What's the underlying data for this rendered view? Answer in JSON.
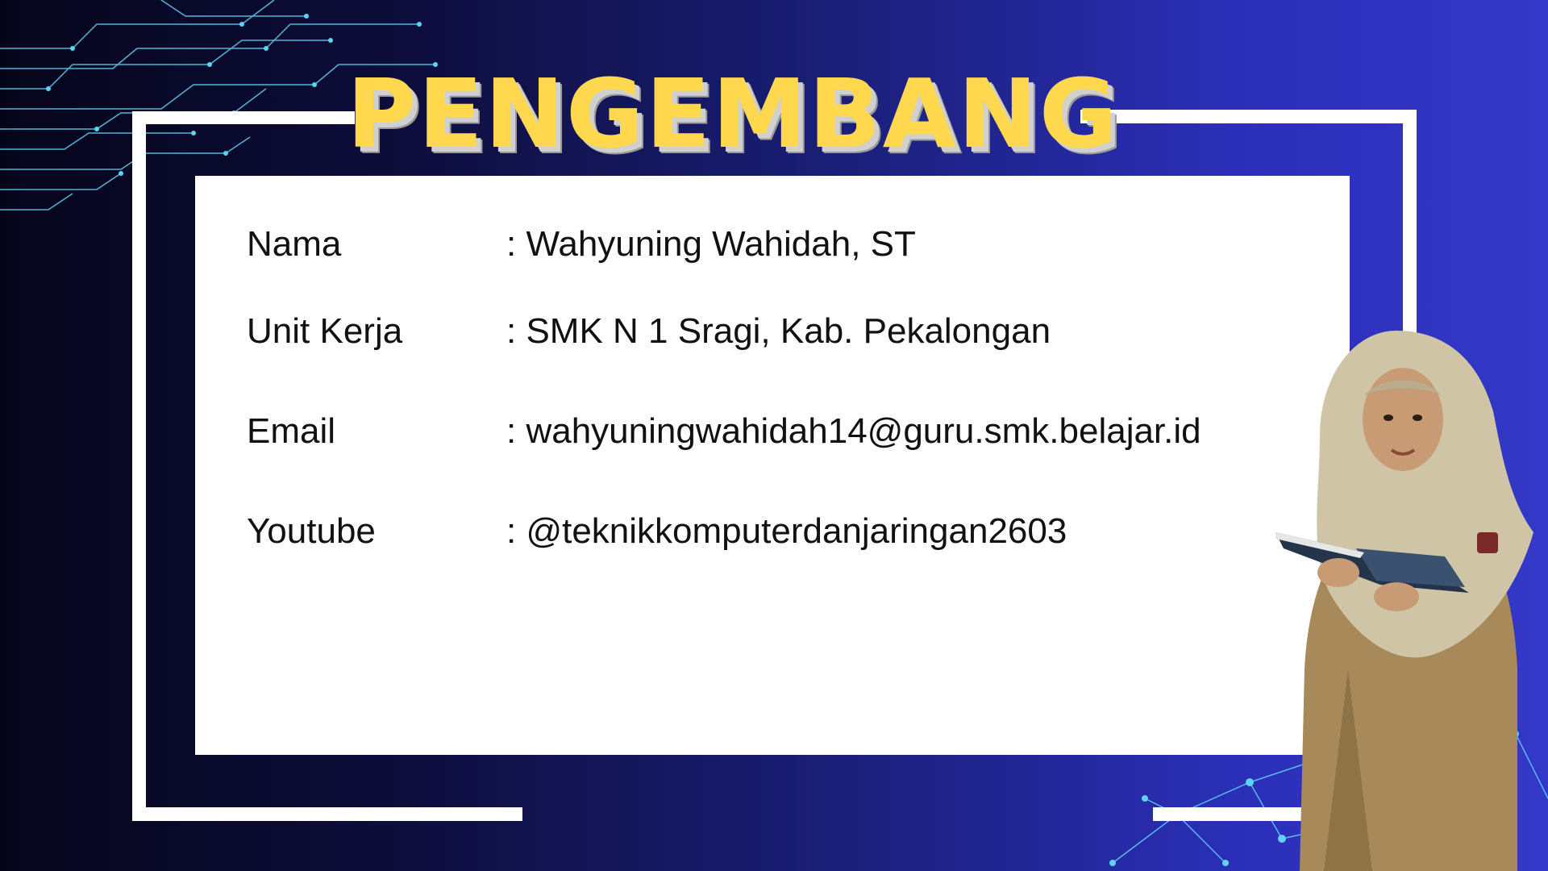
{
  "title": "PENGEMBANG",
  "colors": {
    "title": "#ffd84d",
    "background_dark": "#05051a",
    "background_light": "#3438c8",
    "accent_lines": "#5fd3f3"
  },
  "fields": [
    {
      "label": "Nama",
      "value": ": Wahyuning Wahidah, ST"
    },
    {
      "label": "Unit Kerja",
      "value": ": SMK N 1 Sragi, Kab. Pekalongan"
    },
    {
      "label": "Email",
      "value": ": wahyuningwahidah14@guru.smk.belajar.id"
    },
    {
      "label": "Youtube",
      "value": ": @teknikkomputerdanjaringan2603"
    }
  ],
  "icons": [
    "circuit-lines-icon",
    "network-nodes-icon",
    "person-photo"
  ]
}
